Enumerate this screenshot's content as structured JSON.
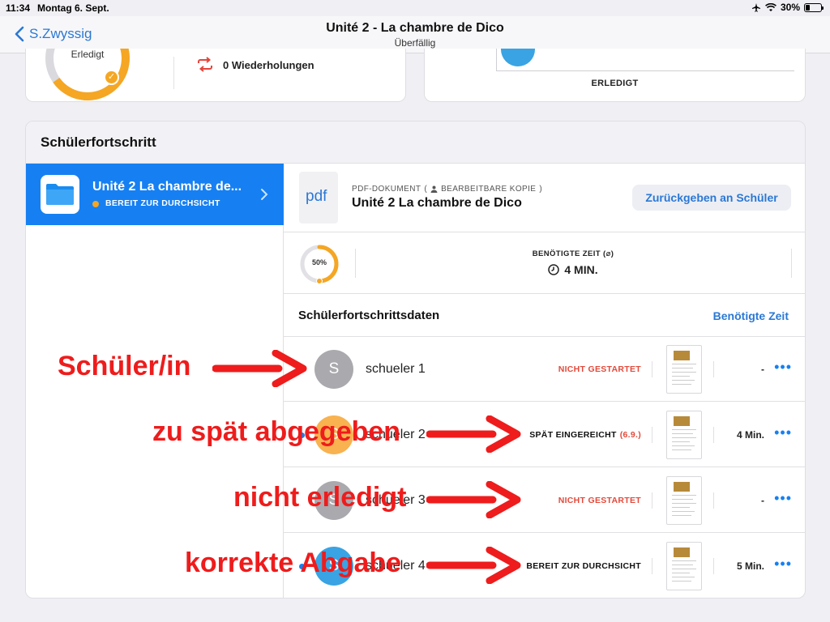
{
  "status_bar": {
    "time": "11:34",
    "date": "Montag 6. Sept.",
    "battery": "30%",
    "battery_level": 0.3
  },
  "nav": {
    "back_label": "S.Zwyssig",
    "title": "Unité 2 - La chambre de Dico",
    "subtitle": "Überfällig"
  },
  "summary": {
    "ring_label": "Erledigt",
    "repeats": "0 Wiederholungen",
    "done_label": "ERLEDIGT"
  },
  "progress": {
    "title": "Schülerfortschritt",
    "sidebar_item": {
      "title": "Unité 2 La chambre de...",
      "status": "BEREIT ZUR DURCHSICHT"
    },
    "doc": {
      "thumb_label": "pdf",
      "type_label": "PDF-DOKUMENT",
      "copy_label": "BEARBEITBARE KOPIE",
      "name": "Unité 2 La chambre de Dico",
      "return_button": "Zurückgeben an Schüler"
    },
    "stats": {
      "percent": "50%",
      "fraction": 0.5,
      "time_label": "BENÖTIGTE ZEIT (⌀)",
      "time_value": "4 MIN."
    },
    "data_title": "Schülerfortschrittsdaten",
    "sort_label": "Benötigte Zeit",
    "students": [
      {
        "initial": "S",
        "name": "schueler 1",
        "status": "NICHT GESTARTET",
        "status_color": "#e24a3b",
        "late_date": "",
        "time": "-",
        "avatar_color": "#a9a9ae",
        "dot": false
      },
      {
        "initial": "S",
        "name": "schueler 2",
        "status": "SPÄT EINGEREICHT",
        "status_color": "#111111",
        "late_date": "(6.9.)",
        "time": "4 Min.",
        "avatar_color": "#f8b24f",
        "dot": true
      },
      {
        "initial": "S",
        "name": "schueler 3",
        "status": "NICHT GESTARTET",
        "status_color": "#e24a3b",
        "late_date": "",
        "time": "-",
        "avatar_color": "#a9a9ae",
        "dot": false
      },
      {
        "initial": "S",
        "name": "schueler 4",
        "status": "BEREIT ZUR DURCHSICHT",
        "status_color": "#111111",
        "late_date": "",
        "time": "5 Min.",
        "avatar_color": "#3aa3e3",
        "dot": true
      }
    ]
  },
  "annotations": {
    "student": "Schüler/in",
    "late": "zu spät abgegeben",
    "not_done": "nicht erledigt",
    "correct": "korrekte Abgabe"
  },
  "colors": {
    "accent": "#1680f2",
    "link": "#2b78d4",
    "orange": "#f5a623",
    "annotation_red": "#ee1c1c"
  }
}
